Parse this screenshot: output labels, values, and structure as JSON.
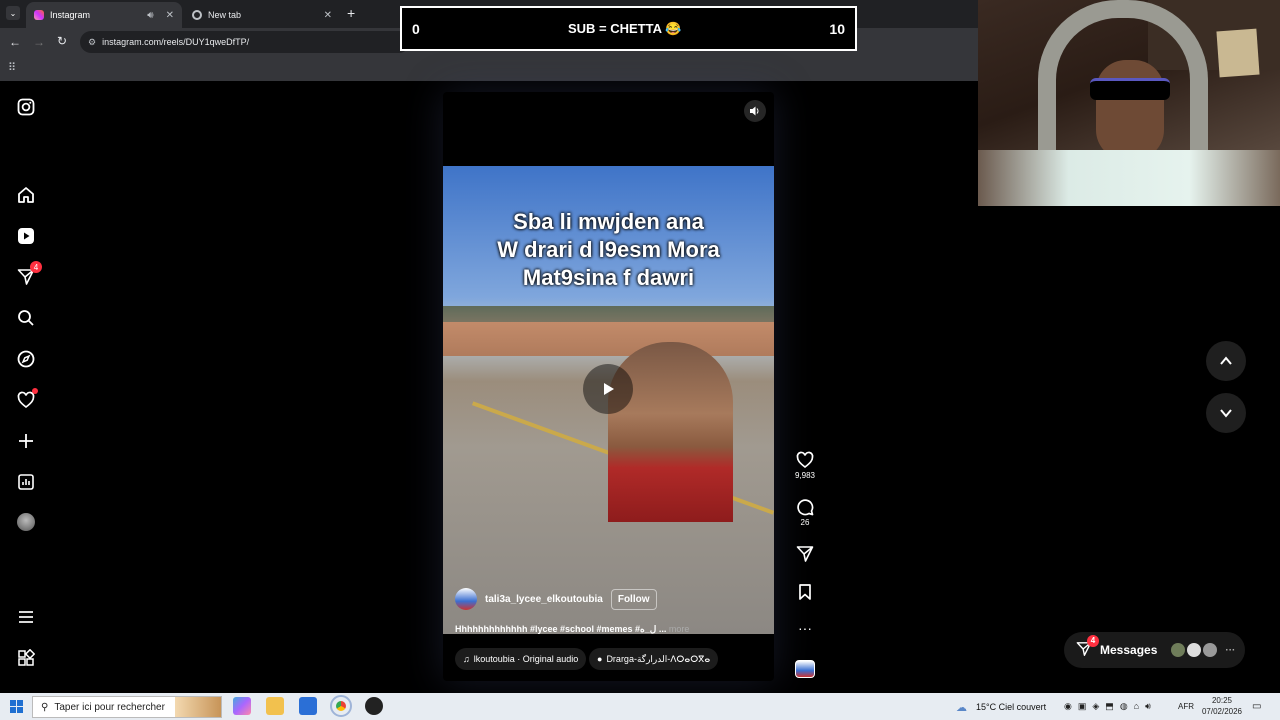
{
  "browser": {
    "tabs": [
      {
        "label": "Instagram",
        "active": true
      },
      {
        "label": "New tab",
        "active": false
      }
    ],
    "url": "instagram.com/reels/DUY1qweDfTP/"
  },
  "overlay": {
    "left_count": "0",
    "center": "SUB = CHETTA 😂",
    "right_count": "10"
  },
  "sidebar": {
    "icons": [
      "instagram-logo",
      "home-icon",
      "reels-icon",
      "direct-icon",
      "search-icon",
      "explore-icon",
      "notifications-icon",
      "create-icon",
      "dashboard-icon",
      "profile-icon",
      "menu-icon",
      "apps-icon"
    ],
    "direct_badge": "4"
  },
  "reel": {
    "caption_overlay": [
      "Sba li mwjden ana",
      "W drari d l9esm Mora",
      "Mat9sina f dawri"
    ],
    "author": "tali3a_lycee_elkoutoubia",
    "follow_label": "Follow",
    "description": "Hhhhhhhhhhhhh #lycee #school #memes #ل_ه ...",
    "description_more": "more",
    "audio": "lkoutoubia · Original audio",
    "location": "Drarga-الدرارگة-ⴷⵔⴰⵔⴳⴰ"
  },
  "actions": {
    "likes": "9,983",
    "comments": "26"
  },
  "messages": {
    "label": "Messages",
    "badge": "4"
  },
  "taskbar": {
    "search_placeholder": "Taper ici pour rechercher",
    "weather": "15°C  Ciel couvert",
    "lang": "AFR",
    "time": "20:25",
    "date": "07/02/2026"
  },
  "colors": {
    "chrome_bg": "#202124",
    "toolbar_bg": "#35363a",
    "badge_red": "#ff3040"
  }
}
